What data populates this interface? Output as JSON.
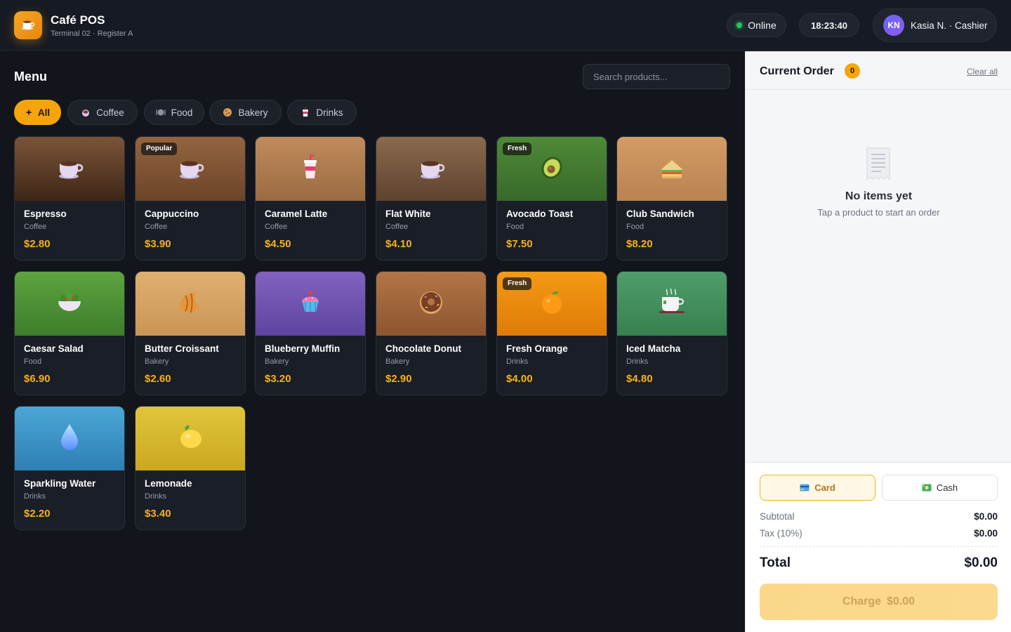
{
  "app": {
    "title": "Café POS",
    "subtitle": "Terminal 02 · Register A",
    "logo_icon": "coffee-cup-icon"
  },
  "header": {
    "status": "Online",
    "clock": "18:23:40",
    "user_initials": "KN",
    "user_label": "Kasia N. · Cashier"
  },
  "menu": {
    "title": "Menu",
    "search_placeholder": "Search products...",
    "categories": [
      {
        "label": "All",
        "icon": "sparkle-icon",
        "active": true
      },
      {
        "label": "Coffee",
        "icon": "coffee-icon",
        "active": false
      },
      {
        "label": "Food",
        "icon": "plate-icon",
        "active": false
      },
      {
        "label": "Bakery",
        "icon": "cookie-icon",
        "active": false
      },
      {
        "label": "Drinks",
        "icon": "cup-icon",
        "active": false
      }
    ]
  },
  "products": [
    {
      "name": "Espresso",
      "category": "Coffee",
      "price": "$2.80",
      "badge": "",
      "icon": "coffee-cup-icon"
    },
    {
      "name": "Cappuccino",
      "category": "Coffee",
      "price": "$3.90",
      "badge": "Popular",
      "icon": "coffee-cup-icon"
    },
    {
      "name": "Caramel Latte",
      "category": "Coffee",
      "price": "$4.50",
      "badge": "",
      "icon": "takeaway-cup-icon"
    },
    {
      "name": "Flat White",
      "category": "Coffee",
      "price": "$4.10",
      "badge": "",
      "icon": "coffee-cup-icon"
    },
    {
      "name": "Avocado Toast",
      "category": "Food",
      "price": "$7.50",
      "badge": "Fresh",
      "icon": "avocado-icon"
    },
    {
      "name": "Club Sandwich",
      "category": "Food",
      "price": "$8.20",
      "badge": "",
      "icon": "sandwich-icon"
    },
    {
      "name": "Caesar Salad",
      "category": "Food",
      "price": "$6.90",
      "badge": "",
      "icon": "salad-icon"
    },
    {
      "name": "Butter Croissant",
      "category": "Bakery",
      "price": "$2.60",
      "badge": "",
      "icon": "croissant-icon"
    },
    {
      "name": "Blueberry Muffin",
      "category": "Bakery",
      "price": "$3.20",
      "badge": "",
      "icon": "cupcake-icon"
    },
    {
      "name": "Chocolate Donut",
      "category": "Bakery",
      "price": "$2.90",
      "badge": "",
      "icon": "donut-icon"
    },
    {
      "name": "Fresh Orange",
      "category": "Drinks",
      "price": "$4.00",
      "badge": "Fresh",
      "icon": "orange-icon"
    },
    {
      "name": "Iced Matcha",
      "category": "Drinks",
      "price": "$4.80",
      "badge": "",
      "icon": "tea-cup-icon"
    },
    {
      "name": "Sparkling Water",
      "category": "Drinks",
      "price": "$2.20",
      "badge": "",
      "icon": "water-drop-icon"
    },
    {
      "name": "Lemonade",
      "category": "Drinks",
      "price": "$3.40",
      "badge": "",
      "icon": "lemon-icon"
    }
  ],
  "order": {
    "title": "Current Order",
    "count": "0",
    "clear_label": "Clear all",
    "empty_title": "No items yet",
    "empty_subtitle": "Tap a product to start an order",
    "payment_methods": [
      {
        "label": "Card",
        "icon": "credit-card-icon",
        "selected": true
      },
      {
        "label": "Cash",
        "icon": "cash-icon",
        "selected": false
      }
    ],
    "subtotal_label": "Subtotal",
    "subtotal": "$0.00",
    "tax_label": "Tax (10%)",
    "tax": "$0.00",
    "total_label": "Total",
    "total": "$0.00",
    "charge_label": "Charge",
    "charge_amount": "$0.00"
  },
  "colors": {
    "accent": "#f5a50b",
    "price": "#f5b21b",
    "online": "#22c55e",
    "background": "#12151c"
  }
}
